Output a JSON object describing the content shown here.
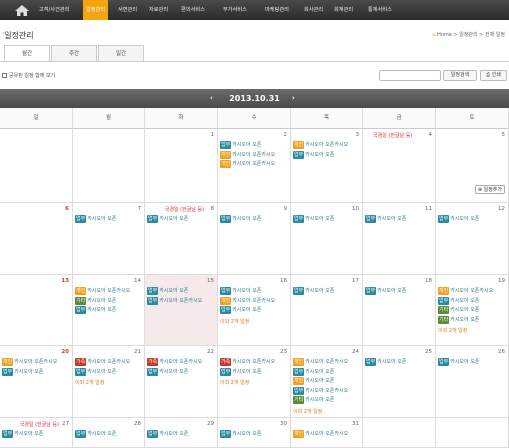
{
  "nav": {
    "items": [
      "고객/사건관리",
      "일정관리",
      "서면관리",
      "자료관리",
      "편의서비스",
      "부가서비스",
      "마케팅관리",
      "회사관리",
      "회계관리",
      "통계서비스"
    ],
    "active_index": 1
  },
  "page": {
    "title": "일정관리",
    "breadcrumb": "Home > 일정관리 > 전체 일정"
  },
  "tabs": [
    "월간",
    "주간",
    "일간"
  ],
  "toolbar": {
    "share_label": "공유된 일정 함께 보기",
    "search_placeholder": "",
    "search_button": "일정검색",
    "print_button": "인쇄"
  },
  "calendar": {
    "month_label": "2013.10.31",
    "prev": "‹",
    "next": "›",
    "weekdays": [
      "일",
      "월",
      "화",
      "수",
      "목",
      "금",
      "토"
    ],
    "add_label": "일정추가",
    "tag_colors": {
      "업무": "#2a8ba0",
      "개인": "#f0a020",
      "가족": "#c0392b",
      "기타": "#5a8a3a"
    },
    "weeks": [
      [
        {
          "day": ""
        },
        {
          "day": ""
        },
        {
          "day": "1"
        },
        {
          "day": "2",
          "events": [
            [
              "업무",
              "카시오아 오픈"
            ],
            [
              "개인",
              "카시오아 오픈카시오"
            ],
            [
              "개인",
              "카시오아 오픈카시오"
            ]
          ]
        },
        {
          "day": "3",
          "events": [
            [
              "개인",
              "카시오아 오픈카시오"
            ],
            [
              "업무",
              "카시오아 오픈"
            ]
          ]
        },
        {
          "day": "4",
          "holiday": "국경일 (한글날 등)"
        },
        {
          "day": "5",
          "add": true
        }
      ],
      [
        {
          "day": "6",
          "red": true
        },
        {
          "day": "7",
          "events": [
            [
              "업무",
              "카시오아 오픈"
            ]
          ]
        },
        {
          "day": "8",
          "holiday": "국경일 (한글날 등)",
          "events": [
            [
              "업무",
              "카시오아 오픈"
            ]
          ]
        },
        {
          "day": "9",
          "events": [
            [
              "업무",
              "카시오아 오픈"
            ]
          ]
        },
        {
          "day": "10",
          "events": [
            [
              "업무",
              "카시오아 오픈"
            ]
          ]
        },
        {
          "day": "11",
          "events": [
            [
              "업무",
              "카시오아 오픈"
            ]
          ]
        },
        {
          "day": "12",
          "events": [
            [
              "업무",
              "카시오아 오픈"
            ]
          ]
        }
      ],
      [
        {
          "day": "13",
          "red": true
        },
        {
          "day": "14",
          "events": [
            [
              "개인",
              "카시오아 오픈카시오"
            ],
            [
              "기타",
              "카시오아 오픈"
            ],
            [
              "업무",
              "카시오아 오픈"
            ]
          ]
        },
        {
          "day": "15",
          "today": true,
          "events": [
            [
              "업무",
              "카시오아 오픈"
            ],
            [
              "업무",
              "카시오아 오픈카시오"
            ]
          ]
        },
        {
          "day": "16",
          "events": [
            [
              "업무",
              "카시오아 오픈"
            ],
            [
              "개인",
              "카시오아 오픈카시오"
            ],
            [
              "업무",
              "카시오아 오픈"
            ]
          ],
          "more": "이외 2개 일정"
        },
        {
          "day": "17",
          "events": [
            [
              "업무",
              "카시오아 오픈"
            ]
          ]
        },
        {
          "day": "18",
          "events": [
            [
              "업무",
              "카시오아 오픈"
            ]
          ]
        },
        {
          "day": "19",
          "events": [
            [
              "개인",
              "카시오아 오픈카시오"
            ],
            [
              "업무",
              "카시오아 오픈"
            ],
            [
              "기타",
              "카시오아 오픈"
            ],
            [
              "기타",
              "카시오아 오픈"
            ]
          ],
          "more": "이외 2개 일정"
        }
      ],
      [
        {
          "day": "20",
          "red": true,
          "events": [
            [
              "개인",
              "카시오아 오픈카시오"
            ],
            [
              "업무",
              "카시오아 오픈"
            ]
          ]
        },
        {
          "day": "21",
          "events": [
            [
              "가족",
              "카시오아 오픈카시오"
            ],
            [
              "업무",
              "카시오아 오픈"
            ]
          ],
          "more": "이외 2개 일정"
        },
        {
          "day": "22",
          "events": [
            [
              "가족",
              "카시오아 오픈카시오"
            ],
            [
              "업무",
              "카시오아 오픈"
            ]
          ]
        },
        {
          "day": "23",
          "events": [
            [
              "가족",
              "카시오아 오픈카시오"
            ],
            [
              "업무",
              "카시오아 오픈"
            ]
          ],
          "more": "이외 2개 일정"
        },
        {
          "day": "24",
          "events": [
            [
              "개인",
              "카시오아 오픈카시오"
            ],
            [
              "업무",
              "카시오아 오픈"
            ],
            [
              "개인",
              "카시오아 오픈"
            ],
            [
              "업무",
              "카시오아 오픈카시오"
            ],
            [
              "기타",
              "카시오아 오픈"
            ]
          ],
          "more": "이외 2개 일정"
        },
        {
          "day": "25",
          "events": [
            [
              "업무",
              "카시오아 오픈"
            ]
          ]
        },
        {
          "day": "26",
          "events": [
            [
              "업무",
              "카시오아 오픈"
            ]
          ]
        }
      ],
      [
        {
          "day": "27",
          "holiday": "국경일 (한글날 등)",
          "events": [
            [
              "업무",
              "카시오아 오픈"
            ]
          ]
        },
        {
          "day": "28",
          "events": [
            [
              "업무",
              "카시오아 오픈"
            ]
          ]
        },
        {
          "day": "29",
          "events": [
            [
              "업무",
              "카시오아 오픈"
            ]
          ]
        },
        {
          "day": "30",
          "events": [
            [
              "업무",
              "카시오아 오픈"
            ]
          ]
        },
        {
          "day": "31",
          "events": [
            [
              "개인",
              "카시오아 오픈카시오"
            ]
          ]
        },
        {
          "day": ""
        },
        {
          "day": ""
        }
      ]
    ]
  }
}
